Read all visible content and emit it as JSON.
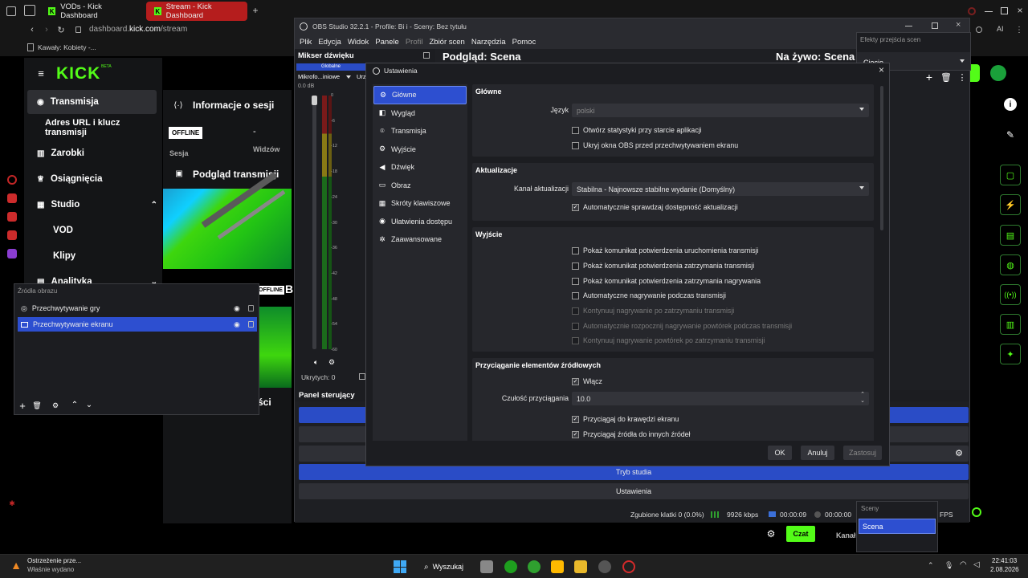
{
  "browser": {
    "tabs": [
      "VODs - Kick Dashboard",
      "Stream - Kick Dashboard"
    ],
    "url_prefix": "dashboard.",
    "url_domain": "kick.com",
    "url_path": "/stream",
    "bookmark": "Kawały: Kobiety -..."
  },
  "kick": {
    "logo": "KICK",
    "beta": "BETA",
    "nav": [
      "Transmisja",
      "Adres URL i klucz transmisji",
      "Zarobki",
      "Osiągnięcia",
      "Studio",
      "VOD",
      "Klipy",
      "Analityka"
    ],
    "session_title": "Informacje o sesji",
    "offline": "OFFLINE",
    "dash": "-",
    "sesja": "Sesja",
    "widzow": "Widzów",
    "preview_title": "Podgląd transmisji",
    "offline2": "OFFLINE",
    "b_letter": "B",
    "sci": "ści",
    "chat_button": "Czat",
    "kana": "Kanał"
  },
  "obs": {
    "title": "OBS Studio 32.2.1 - Profile: Bi i - Sceny: Bez tytułu",
    "menu": [
      "Plik",
      "Edycja",
      "Widok",
      "Panele",
      "Profil",
      "Zbiór scen",
      "Narzędzia",
      "Pomoc"
    ],
    "mixer_title": "Mikser dźwięku",
    "mixer_global": "Globalne",
    "mixer_channel": "Mikrofo...iniowe",
    "mixer_channel2": "Urz",
    "mixer_db": "0.0 dB",
    "meter_ticks": [
      "0",
      "-6",
      "-12",
      "-18",
      "-24",
      "-30",
      "-36",
      "-42",
      "-48",
      "-54",
      "-60"
    ],
    "hidden": "Ukrytych: 0",
    "preview": "Podgląd: Scena",
    "live": "Na żywo: Scena",
    "control_panel": "Panel sterujący",
    "studio_mode": "Tryb studia",
    "settings": "Ustawienia",
    "status": {
      "dropped": "Zgubione klatki 0 (0.0%)",
      "kbps": "9926 kbps",
      "rec_time": "00:00:09",
      "stream_time": "00:00:00",
      "fps": "FPS"
    },
    "transitions_title": "Efekty przejścia scen",
    "transition_value": "Cięcie",
    "scenes_title": "Sceny",
    "scene_item": "Scena"
  },
  "sources": {
    "title": "Źródła obrazu",
    "items": [
      "Przechwytywanie gry",
      "Przechwytywanie ekranu"
    ]
  },
  "dialog": {
    "title": "Ustawienia",
    "nav": [
      "Główne",
      "Wygląd",
      "Transmisja",
      "Wyjście",
      "Dźwięk",
      "Obraz",
      "Skróty klawiszowe",
      "Ułatwienia dostępu",
      "Zaawansowane"
    ],
    "general": {
      "header": "Główne",
      "lang_label": "Język",
      "lang_value": "polski",
      "cb1": "Otwórz statystyki przy starcie aplikacji",
      "cb2": "Ukryj okna OBS przed przechwytywaniem ekranu"
    },
    "updates": {
      "header": "Aktualizacje",
      "channel_label": "Kanał aktualizacji",
      "channel_value": "Stabilna - Najnowsze stabilne wydanie (Domyślny)",
      "cb": "Automatycznie sprawdzaj dostępność aktualizacji"
    },
    "output": {
      "header": "Wyjście",
      "items": [
        "Pokaż komunikat potwierdzenia uruchomienia transmisji",
        "Pokaż komunikat potwierdzenia zatrzymania transmisji",
        "Pokaż komunikat potwierdzenia zatrzymania nagrywania",
        "Automatyczne nagrywanie podczas transmisji",
        "Kontynuuj nagrywanie po zatrzymaniu transmisji",
        "Automatycznie rozpocznij nagrywanie powtórek podczas transmisji",
        "Kontynuuj nagrywanie powtórek po zatrzymaniu transmisji"
      ]
    },
    "snap": {
      "header": "Przyciąganie elementów źródłowych",
      "enable": "Włącz",
      "sens_label": "Czułość przyciągania",
      "sens_value": "10.0",
      "cb1": "Przyciągaj do krawędzi ekranu",
      "cb2": "Przyciągaj źródła do innych źródeł"
    },
    "buttons": {
      "ok": "OK",
      "cancel": "Anuluj",
      "apply": "Zastosuj"
    }
  },
  "taskbar": {
    "notif_title": "Ostrzeżenie prze...",
    "notif_sub": "Właśnie wydano",
    "search": "Wyszukaj",
    "time": "22:41:03",
    "date": "2.08.2026"
  },
  "colors": {
    "kick_green": "#53fc18",
    "obs_blue": "#2d4fd0"
  }
}
